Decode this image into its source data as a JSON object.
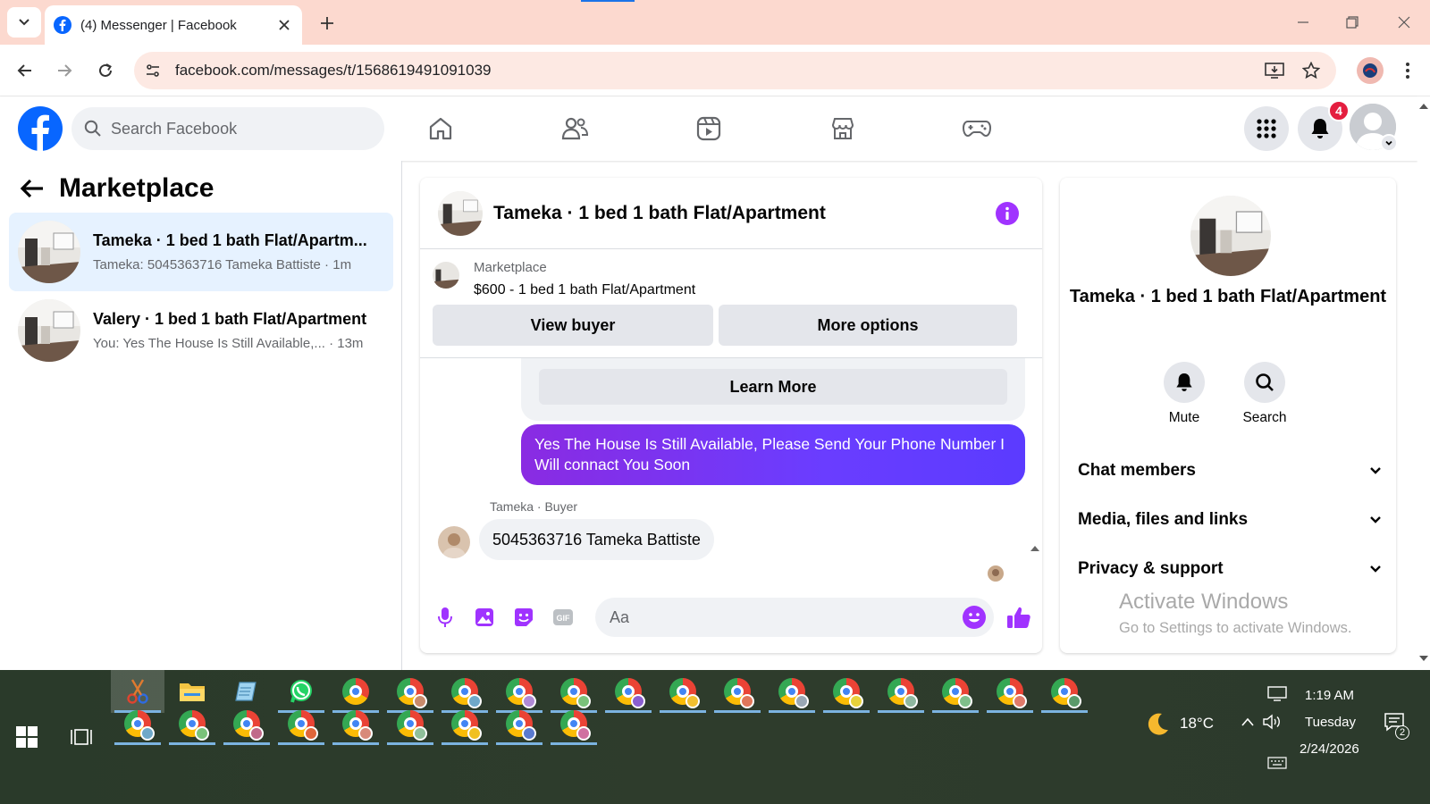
{
  "browser": {
    "tab_title": "(4) Messenger | Facebook",
    "url": "facebook.com/messages/t/1568619491091039"
  },
  "header": {
    "search_placeholder": "Search Facebook",
    "notification_count": "4"
  },
  "left": {
    "title": "Marketplace",
    "conversations": [
      {
        "name": "Tameka · 1 bed 1 bath Flat/Apartm...",
        "preview": "Tameka: 5045363716 Tameka Battiste · 1m",
        "active": true
      },
      {
        "name": "Valery · 1 bed 1 bath Flat/Apartment",
        "preview": "You: Yes The House Is Still Available,... · 13m",
        "active": false
      }
    ]
  },
  "chat": {
    "title": "Tameka · 1 bed 1 bath Flat/Apartment",
    "marketplace_label": "Marketplace",
    "listing": "$600 - 1 bed 1 bath Flat/Apartment",
    "view_buyer": "View buyer",
    "more_options": "More options",
    "learn_more": "Learn More",
    "outgoing_message": "Yes The House Is Still Available, Please Send Your Phone Number I Will connact You Soon",
    "sender_label": "Tameka · Buyer",
    "incoming_message": "5045363716 Tameka Battiste",
    "composer_placeholder": "Aa"
  },
  "info_panel": {
    "name": "Tameka · 1 bed 1 bath Flat/Apartment",
    "mute": "Mute",
    "search": "Search",
    "sections": [
      "Chat members",
      "Media, files and links",
      "Privacy & support"
    ]
  },
  "watermark": {
    "line1": "Activate Windows",
    "line2": "Go to Settings to activate Windows."
  },
  "taskbar": {
    "temperature": "18°C",
    "time": "1:19 AM",
    "day": "Tuesday",
    "date": "2/24/2026",
    "notification_count": "2"
  },
  "colors": {
    "fb_blue": "#0866ff",
    "messenger_purple": "#a033ff",
    "outgoing_bubble": "#6a3dff",
    "badge_red": "#e41e3f",
    "tab_strip": "#fcd9cf"
  }
}
